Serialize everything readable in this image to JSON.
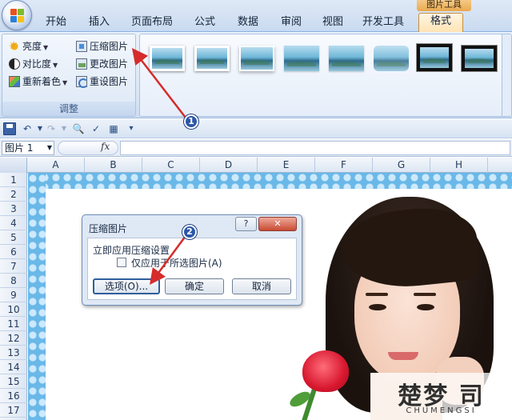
{
  "context_tab": "图片工具",
  "tabs": [
    "开始",
    "插入",
    "页面布局",
    "公式",
    "数据",
    "审阅",
    "视图",
    "开发工具",
    "格式"
  ],
  "adjust_group": {
    "label": "调整",
    "brightness": "亮度",
    "contrast": "对比度",
    "recolor": "重新着色",
    "compress": "压缩图片",
    "change": "更改图片",
    "reset": "重设图片"
  },
  "formula_bar": {
    "name_box": "图片 1",
    "fx": "fx"
  },
  "columns": [
    "A",
    "B",
    "C",
    "D",
    "E",
    "F",
    "G",
    "H"
  ],
  "rows": [
    "1",
    "2",
    "3",
    "4",
    "5",
    "6",
    "7",
    "8",
    "9",
    "10",
    "11",
    "12",
    "13",
    "14",
    "15",
    "16",
    "17"
  ],
  "dialog": {
    "title": "压缩图片",
    "help": "?",
    "close": "✕",
    "section": "立即应用压缩设置",
    "checkbox_label": "仅应用于所选图片(A)",
    "checked": false,
    "options_button": "选项(O)...",
    "ok_button": "确定",
    "cancel_button": "取消"
  },
  "annotations": {
    "step1": "1",
    "step2": "2",
    "arrow_color": "#d62b2b"
  },
  "watermark": {
    "main": "楚梦 司",
    "sub": "CHUMENGSI"
  }
}
